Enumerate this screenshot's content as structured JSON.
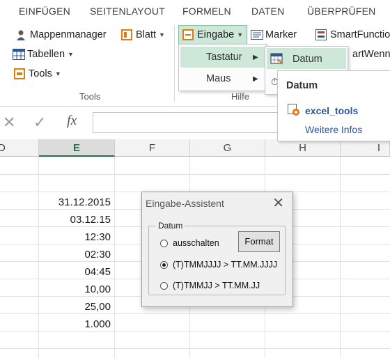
{
  "ribbon_tabs": [
    "EINFÜGEN",
    "SEITENLAYOUT",
    "FORMELN",
    "DATEN",
    "ÜBERPRÜFEN"
  ],
  "ribbon": {
    "mappenmanager": "Mappenmanager",
    "tabellen": "Tabellen",
    "tools": "Tools",
    "blatt": "Blatt",
    "eingabe": "Eingabe",
    "marker": "Marker",
    "smartfunction": "SmartFunctio",
    "smartwenn": "artWenn",
    "group_tools": "Tools",
    "group_hilfe": "Hilfe"
  },
  "formula_bar": {
    "fx": "fx"
  },
  "columns": [
    "D",
    "E",
    "F",
    "G",
    "H",
    "I"
  ],
  "selected_column": "E",
  "cells_e": [
    "31.12.2015",
    "03.12.15",
    "12:30",
    "02:30",
    "04:45",
    "10,00",
    "25,00",
    "1.000"
  ],
  "menu_eingabe": {
    "items": [
      "Tastatur",
      "Maus"
    ]
  },
  "submenu_tastatur": {
    "items": [
      "Datum"
    ]
  },
  "tooltip": {
    "title": "Datum",
    "link": "excel_tools",
    "more": "Weitere Infos"
  },
  "dialog": {
    "title": "Eingabe-Assistent",
    "group_label": "Datum",
    "options": [
      "ausschalten",
      "(T)TMMJJJJ > TT.MM.JJJJ",
      "(T)TMMJJ > TT.MM.JJ"
    ],
    "selected_option": 1,
    "format_button": "Format"
  },
  "colors": {
    "excel_green": "#217346",
    "menu_highlight": "#cde8d8",
    "link_blue": "#2b579a"
  }
}
